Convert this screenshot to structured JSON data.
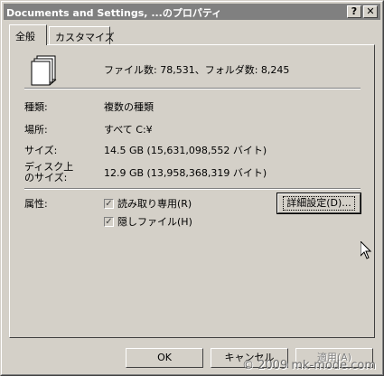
{
  "window": {
    "title": "Documents and Settings, ...のプロパティ",
    "help_label": "?",
    "close_label": "✕"
  },
  "tabs": [
    {
      "label": "全般",
      "active": true
    },
    {
      "label": "カスタマイズ",
      "active": false
    }
  ],
  "general": {
    "summary": "ファイル数: 78,531、フォルダ数: 8,245",
    "icon": "folder-stack-icon",
    "rows": [
      {
        "label": "種類:",
        "value": "複数の種類"
      },
      {
        "label": "場所:",
        "value": "すべて C:¥"
      },
      {
        "label": "サイズ:",
        "value": "14.5 GB (15,631,098,552 バイト)"
      },
      {
        "label": "ディスク上\nのサイズ:",
        "value": "12.9 GB (13,958,368,319 バイト)"
      }
    ],
    "attributes_label": "属性:",
    "readonly_label": "読み取り専用(R)",
    "readonly_checked": true,
    "hidden_label": "隠しファイル(H)",
    "hidden_checked": true,
    "advanced_label": "詳細設定(D)..."
  },
  "buttons": {
    "ok": "OK",
    "cancel": "キャンセル",
    "apply": "適用(A)"
  },
  "watermark": "© 2009 mk-mode.com",
  "colors": {
    "face": "#d4d0c8",
    "titlebar_inactive": "#808080",
    "disabled_text": "#808080"
  }
}
